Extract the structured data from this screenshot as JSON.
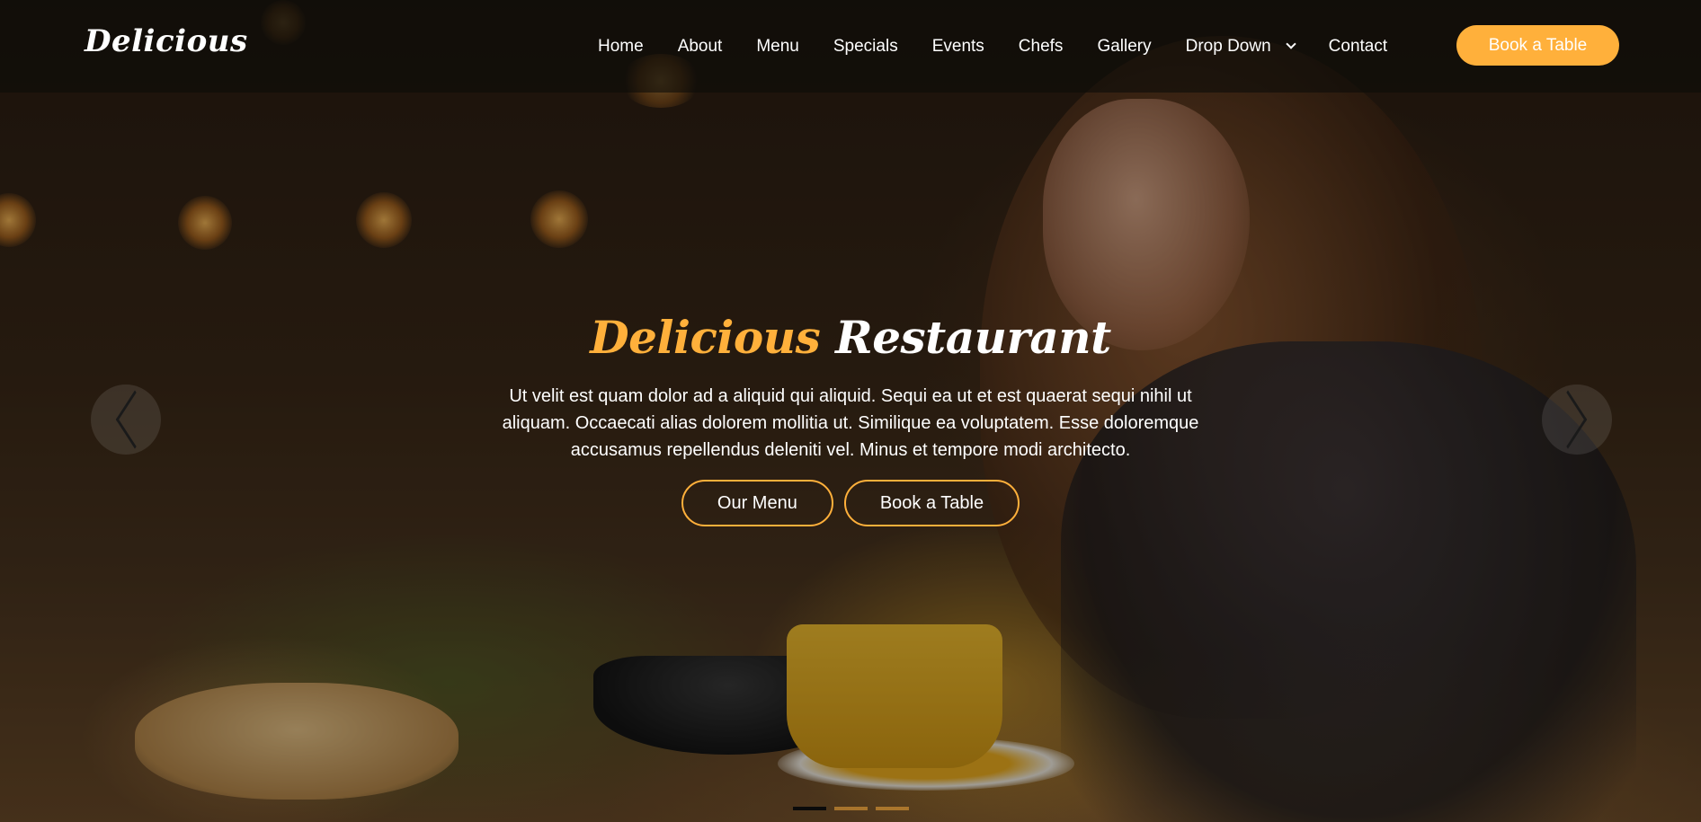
{
  "brand": {
    "logo": "Delicious",
    "accent_color": "#ffb03b"
  },
  "nav": {
    "items": [
      "Home",
      "About",
      "Menu",
      "Specials",
      "Events",
      "Chefs",
      "Gallery",
      "Drop Down",
      "Contact"
    ],
    "book_label": "Book a Table"
  },
  "hero": {
    "title_accent": "Delicious",
    "title_main": "Restaurant",
    "description": "Ut velit est quam dolor ad a aliquid qui aliquid. Sequi ea ut et est quaerat sequi nihil ut aliquam. Occaecati alias dolorem mollitia ut. Similique ea voluptatem. Esse doloremque accusamus repellendus deleniti vel. Minus et tempore modi architecto.",
    "menu_button": "Our Menu",
    "book_button": "Book a Table"
  },
  "carousel": {
    "slide_count": 3,
    "active_slide": 1,
    "prev_icon": "chevron-left-icon",
    "next_icon": "chevron-right-icon"
  }
}
